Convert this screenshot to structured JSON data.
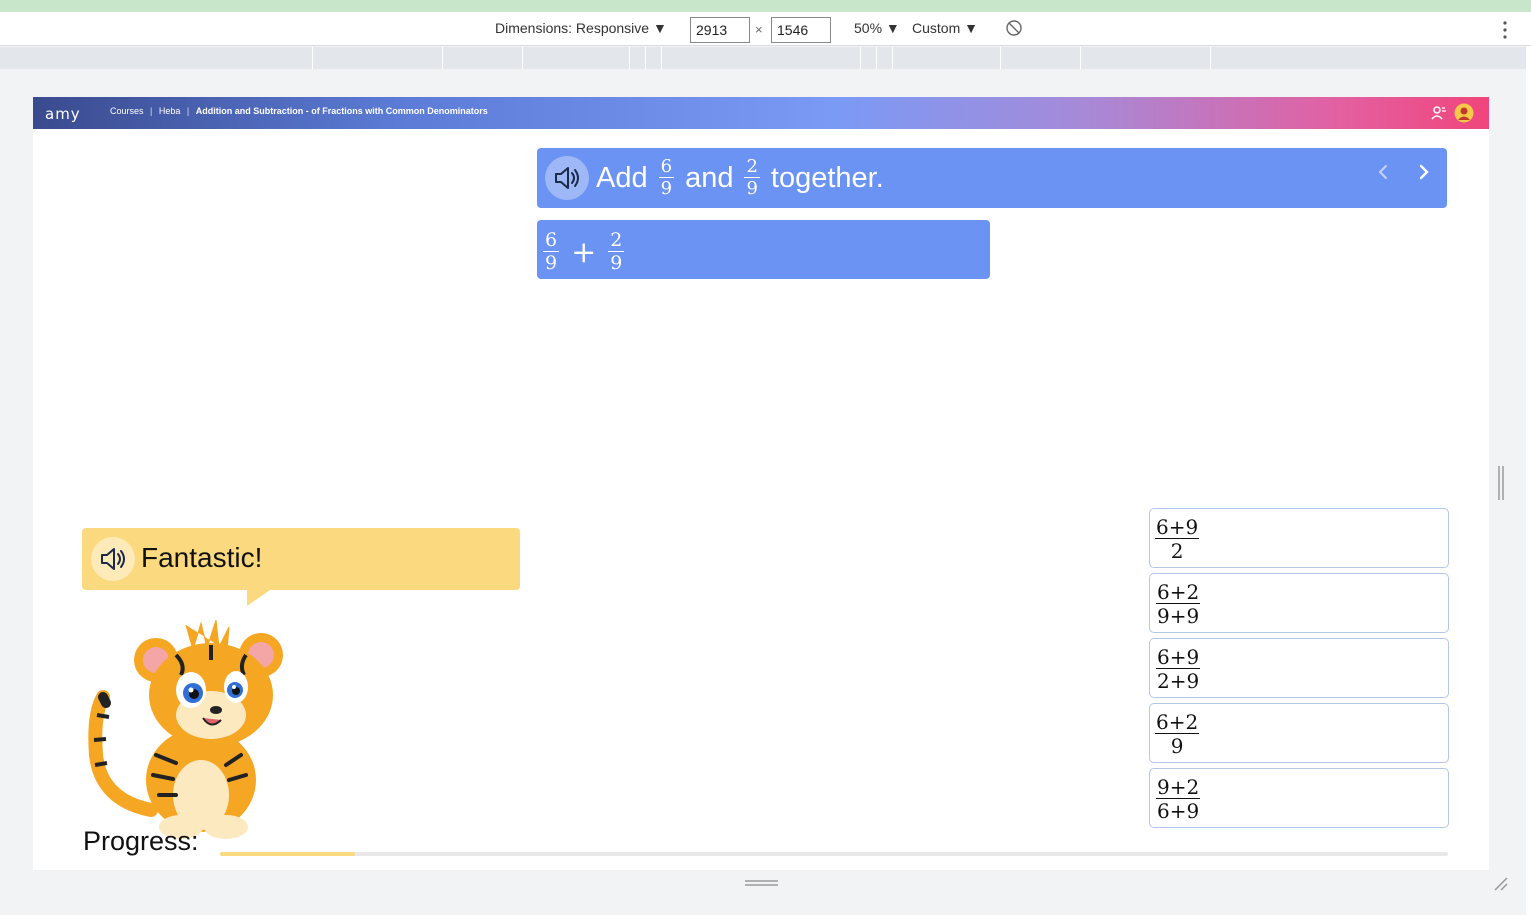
{
  "devtools": {
    "dimensions_label": "Dimensions: Responsive ▼",
    "width_value": "2913",
    "height_value": "1546",
    "times": "×",
    "zoom": "50% ▼",
    "throttle": "Custom ▼"
  },
  "app": {
    "logo": "amy",
    "breadcrumb": {
      "courses": "Courses",
      "sep1": "|",
      "user": "Heba",
      "sep2": "|",
      "lesson": "Addition and Subtraction - of Fractions with Common Denominators"
    }
  },
  "question": {
    "prefix": "Add",
    "frac1": {
      "num": "6",
      "den": "9"
    },
    "middle": "and",
    "frac2": {
      "num": "2",
      "den": "9"
    },
    "suffix": "together."
  },
  "expression": {
    "frac1": {
      "num": "6",
      "den": "9"
    },
    "operator": "+",
    "frac2": {
      "num": "2",
      "den": "9"
    }
  },
  "feedback": {
    "message": "Fantastic!"
  },
  "options": [
    {
      "num": "6+9",
      "den": "2"
    },
    {
      "num": "6+2",
      "den": "9+9"
    },
    {
      "num": "6+9",
      "den": "2+9"
    },
    {
      "num": "6+2",
      "den": "9"
    },
    {
      "num": "9+2",
      "den": "6+9"
    }
  ],
  "progress": {
    "label": "Progress:",
    "fraction": 0.11
  },
  "colors": {
    "accent_blue": "#6b93f3",
    "bubble_yellow": "#fbd97f",
    "tiger_orange": "#f5a623"
  }
}
